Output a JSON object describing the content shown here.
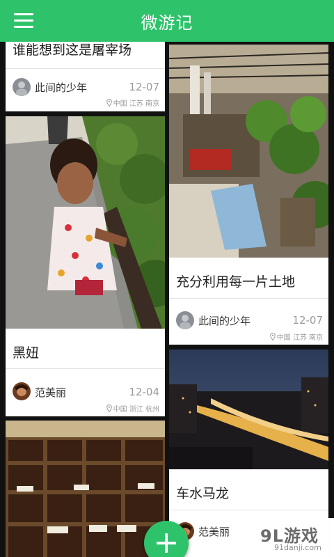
{
  "header": {
    "title": "微游记",
    "menu_icon": "hamburger-menu-icon"
  },
  "colors": {
    "accent": "#2ec26b",
    "card_bg": "#ffffff",
    "page_bg": "#111111"
  },
  "feed": {
    "left": [
      {
        "title": "谁能想到这是屠宰场",
        "author": "此间的少年",
        "date": "12-07",
        "location": "中国 江苏 南京"
      },
      {
        "title": "黑妞",
        "author": "范美丽",
        "date": "12-04",
        "location": "中国 浙江 杭州"
      },
      {
        "photo": "chocolate-display-photo"
      }
    ],
    "right": [
      {
        "title": "充分利用每一片土地",
        "author": "此间的少年",
        "date": "12-07",
        "location": "中国 江苏 南京"
      },
      {
        "title": "车水马龙",
        "author": "范美丽"
      }
    ]
  },
  "fab": {
    "icon": "plus-icon"
  },
  "watermark": {
    "main": "9L游戏",
    "sub": "91danji.com"
  }
}
